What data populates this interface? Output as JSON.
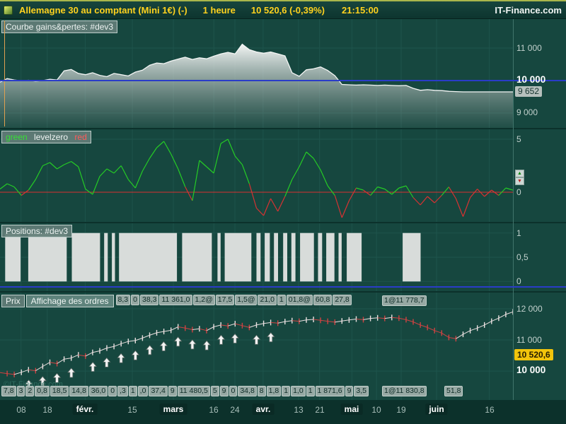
{
  "header": {
    "title": "Allemagne 30 au comptant (Mini 1€) (-)",
    "timeframe": "1 heure",
    "price": "10 520,6 (-0,39%)",
    "time": "21:15:00",
    "brand": "IT-Finance.com"
  },
  "panels": {
    "equity": {
      "label": "Courbe gains&pertes: #dev3",
      "axis": [
        "11 000",
        "10 000",
        "9 652",
        "9 000"
      ]
    },
    "osc": {
      "legend": [
        {
          "text": "green",
          "color": "#35e035"
        },
        {
          "text": "levelzero",
          "color": "#eef4f2"
        },
        {
          "text": "red",
          "color": "#ff5a5a"
        }
      ],
      "axis": [
        "5",
        "0"
      ]
    },
    "positions": {
      "label": "Positions: #dev3",
      "axis": [
        "1",
        "0,5",
        "0"
      ]
    },
    "price": {
      "label": "Prix",
      "orders_label": "Affichage des ordres",
      "axis": [
        "12 000",
        "11 000",
        "10 520,6",
        "10 000"
      ]
    }
  },
  "orders_top": [
    "8,3",
    "0",
    "38,3",
    "11 361,0",
    "1,2@",
    "17,5",
    "1,5@",
    "21,0",
    "1",
    "01,8@",
    "60,8",
    "27,8"
  ],
  "orders_top_right": "1@11 778,7",
  "orders_bottom": [
    "7,8",
    "3",
    "2",
    "0,8",
    "18,5",
    "14,8",
    "36,0",
    "0",
    ",3",
    "1",
    ",0",
    "37,4",
    "9",
    "11 480,5",
    "5",
    "9",
    "0",
    "34,8",
    "8",
    "1,8",
    "1",
    "1,0",
    "1",
    "1 871,6",
    "9",
    "3,5"
  ],
  "orders_bottom_right": [
    "1@11 830,8",
    "51,8"
  ],
  "watermark": "©IT-Finance.com",
  "spin": {
    "up": "▲",
    "down": "▼"
  },
  "timeline": {
    "ticks": [
      {
        "f": 0.041,
        "t": "08",
        "m": false
      },
      {
        "f": 0.092,
        "t": "18",
        "m": false
      },
      {
        "f": 0.166,
        "t": "févr.",
        "m": true
      },
      {
        "f": 0.258,
        "t": "15",
        "m": false
      },
      {
        "f": 0.338,
        "t": "mars",
        "m": true
      },
      {
        "f": 0.417,
        "t": "16",
        "m": false
      },
      {
        "f": 0.458,
        "t": "24",
        "m": false
      },
      {
        "f": 0.513,
        "t": "avr.",
        "m": true
      },
      {
        "f": 0.582,
        "t": "13",
        "m": false
      },
      {
        "f": 0.623,
        "t": "21",
        "m": false
      },
      {
        "f": 0.686,
        "t": "mai",
        "m": true
      },
      {
        "f": 0.734,
        "t": "10",
        "m": false
      },
      {
        "f": 0.782,
        "t": "19",
        "m": false
      },
      {
        "f": 0.851,
        "t": "juin",
        "m": true
      },
      {
        "f": 0.954,
        "t": "16",
        "m": false
      }
    ]
  },
  "colors": {
    "grid": "#1e544c",
    "blue": "#2a3cc8",
    "green": "#25cc25",
    "red": "#d83232",
    "equity_line": "#f4f6f5",
    "candle_up": "#eae0e0",
    "candle_down": "#d04242",
    "accent_yellow": "#ffd21e",
    "badge_yellow": "#f2c40c"
  },
  "chart_data": [
    {
      "id": "equity",
      "type": "area",
      "title": "Courbe gains&pertes: #dev3",
      "ylim": [
        8543,
        11891
      ],
      "grid_y": [
        11000,
        10000,
        9000
      ],
      "baseline": 10000,
      "last_value": 9652,
      "values": [
        9950,
        10060,
        10020,
        9990,
        10010,
        9980,
        10000,
        10040,
        10020,
        10300,
        10340,
        10220,
        10180,
        10240,
        10160,
        10120,
        10220,
        10180,
        10140,
        10260,
        10320,
        10470,
        10540,
        10520,
        10600,
        10660,
        10720,
        10650,
        10700,
        10670,
        10750,
        10820,
        10870,
        10820,
        11120,
        10950,
        10880,
        10840,
        10880,
        10820,
        10760,
        10240,
        10130,
        10330,
        10360,
        10420,
        10310,
        10150,
        9880,
        9870,
        9860,
        9870,
        9860,
        9850,
        9860,
        9850,
        9840,
        9850,
        9760,
        9700,
        9720,
        9700,
        9690,
        9670,
        9660,
        9652,
        9652,
        9652,
        9652,
        9652,
        9652,
        9652,
        9652
      ]
    },
    {
      "id": "oscillator",
      "type": "line",
      "title": "green levelzero red",
      "ylim": [
        -2.8,
        5.93
      ],
      "grid_y": [
        5,
        0
      ],
      "zero_line": 0,
      "values": [
        0.3,
        0.8,
        0.5,
        -0.3,
        0.2,
        1.2,
        2.5,
        2.8,
        2.2,
        2.6,
        2.9,
        2.4,
        0.3,
        -0.2,
        1.5,
        2.2,
        1.8,
        2.5,
        1.2,
        0.4,
        2.0,
        3.2,
        4.2,
        4.8,
        3.6,
        2.2,
        0.5,
        -0.8,
        3.0,
        2.4,
        1.8,
        4.6,
        5.0,
        3.4,
        2.6,
        0.8,
        -1.5,
        -2.2,
        -0.6,
        -1.8,
        -0.4,
        1.2,
        2.4,
        3.8,
        3.2,
        2.1,
        0.6,
        -0.3,
        -2.4,
        -0.8,
        0.4,
        0.2,
        -0.3,
        0.5,
        0.3,
        -0.2,
        0.4,
        0.6,
        -0.5,
        -1.2,
        -0.4,
        -1.0,
        -0.3,
        0.5,
        -0.6,
        -2.3,
        -0.5,
        0.3,
        -0.4,
        0.2,
        -0.3,
        0.4,
        0.2
      ]
    },
    {
      "id": "positions",
      "type": "binary-blocks",
      "title": "Positions: #dev3",
      "ylim": [
        -0.2,
        1.2
      ],
      "grid_y": [
        1,
        0.5,
        0
      ],
      "segments": [
        [
          0.01,
          0.04
        ],
        [
          0.055,
          0.13
        ],
        [
          0.14,
          0.195
        ],
        [
          0.203,
          0.21
        ],
        [
          0.218,
          0.224
        ],
        [
          0.232,
          0.345
        ],
        [
          0.355,
          0.413
        ],
        [
          0.424,
          0.43
        ],
        [
          0.438,
          0.49
        ],
        [
          0.5,
          0.508
        ],
        [
          0.516,
          0.526
        ],
        [
          0.534,
          0.542
        ],
        [
          0.552,
          0.56
        ],
        [
          0.568,
          0.576
        ],
        [
          0.585,
          0.612
        ],
        [
          0.62,
          0.628
        ],
        [
          0.636,
          0.652
        ],
        [
          0.66,
          0.666
        ],
        [
          0.676,
          0.705
        ],
        [
          0.785,
          0.82
        ]
      ]
    },
    {
      "id": "price",
      "type": "candles",
      "title": "Prix",
      "ylim": [
        9071,
        12522
      ],
      "grid_y": [
        12000,
        11000,
        10000
      ],
      "last_price": "10 520,6",
      "values": [
        9950,
        9920,
        9890,
        9960,
        10040,
        10010,
        10150,
        10280,
        10240,
        10380,
        10420,
        10520,
        10480,
        10600,
        10650,
        10740,
        10790,
        10880,
        10950,
        10980,
        11060,
        11150,
        11230,
        11270,
        11310,
        11420,
        11380,
        11330,
        11360,
        11300,
        11420,
        11480,
        11450,
        11520,
        11460,
        11400,
        11480,
        11530,
        11560,
        11540,
        11590,
        11620,
        11600,
        11640,
        11660,
        11630,
        11600,
        11570,
        11610,
        11640,
        11670,
        11650,
        11690,
        11710,
        11690,
        11720,
        11700,
        11650,
        11580,
        11480,
        11400,
        11300,
        11220,
        11080,
        11040,
        11180,
        11300,
        11380,
        11480,
        11600,
        11700,
        11820,
        11900
      ],
      "arrows": [
        [
          0.056,
          9850
        ],
        [
          0.083,
          9960
        ],
        [
          0.111,
          10060
        ],
        [
          0.139,
          10230
        ],
        [
          0.181,
          10420
        ],
        [
          0.208,
          10560
        ],
        [
          0.236,
          10700
        ],
        [
          0.264,
          10790
        ],
        [
          0.292,
          10960
        ],
        [
          0.319,
          11080
        ],
        [
          0.347,
          11230
        ],
        [
          0.375,
          11140
        ],
        [
          0.403,
          11110
        ],
        [
          0.431,
          11290
        ],
        [
          0.458,
          11330
        ],
        [
          0.5,
          11290
        ],
        [
          0.528,
          11370
        ]
      ]
    }
  ]
}
